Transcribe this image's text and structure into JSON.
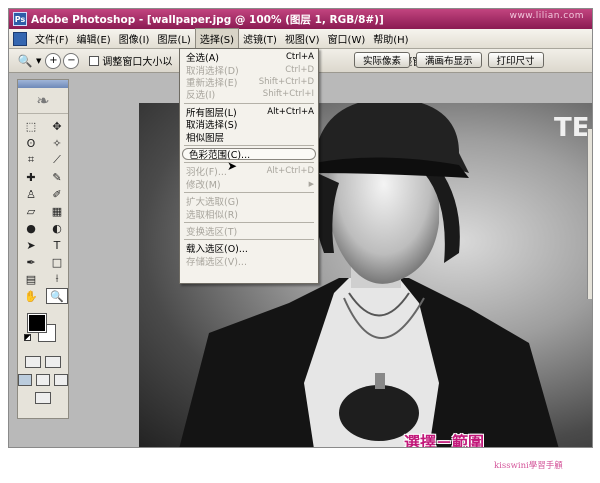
{
  "window": {
    "title": "Adobe Photoshop - [wallpaper.jpg @ 100% (图层 1, RGB/8#)]",
    "watermark": "www.lilian.com"
  },
  "menubar": {
    "items": [
      "文件(F)",
      "编辑(E)",
      "图像(I)",
      "图层(L)",
      "选择(S)",
      "滤镜(T)",
      "视图(V)",
      "窗口(W)",
      "帮助(H)"
    ],
    "active_index": 4
  },
  "options": {
    "checkbox_label": "调整窗口大小以",
    "hidden_label": "满画布显示",
    "label2": "调整窗口",
    "buttons": [
      "实际像素",
      "满画布显示",
      "打印尺寸"
    ]
  },
  "select_menu": {
    "rows": [
      {
        "label": "全选(A)",
        "shortcut": "Ctrl+A",
        "disabled": false
      },
      {
        "label": "取消选择(D)",
        "shortcut": "Ctrl+D",
        "disabled": true
      },
      {
        "label": "重新选择(E)",
        "shortcut": "Shift+Ctrl+D",
        "disabled": true
      },
      {
        "label": "反选(I)",
        "shortcut": "Shift+Ctrl+I",
        "disabled": true
      },
      {
        "sep": true
      },
      {
        "label": "所有图层(L)",
        "shortcut": "Alt+Ctrl+A",
        "disabled": false
      },
      {
        "label": "取消选择(S)",
        "shortcut": "",
        "disabled": false
      },
      {
        "label": "相似图层",
        "shortcut": "",
        "disabled": false
      },
      {
        "sep": true
      },
      {
        "label": "色彩范围(C)...",
        "shortcut": "",
        "disabled": false,
        "highlight": true
      },
      {
        "sep": true
      },
      {
        "label": "羽化(F)...",
        "shortcut": "Alt+Ctrl+D",
        "disabled": true
      },
      {
        "label": "修改(M)",
        "shortcut": "",
        "disabled": true,
        "submenu": true
      },
      {
        "sep": true
      },
      {
        "label": "扩大选取(G)",
        "shortcut": "",
        "disabled": true
      },
      {
        "label": "选取相似(R)",
        "shortcut": "",
        "disabled": true
      },
      {
        "sep": true
      },
      {
        "label": "变换选区(T)",
        "shortcut": "",
        "disabled": true
      },
      {
        "sep": true
      },
      {
        "label": "载入选区(O)...",
        "shortcut": "",
        "disabled": false
      },
      {
        "label": "存储选区(V)...",
        "shortcut": "",
        "disabled": true
      }
    ]
  },
  "document": {
    "corner_text": "TE",
    "annotation": "選擇－範圍"
  },
  "footer": {
    "credit": "kisswini學習手顧"
  }
}
